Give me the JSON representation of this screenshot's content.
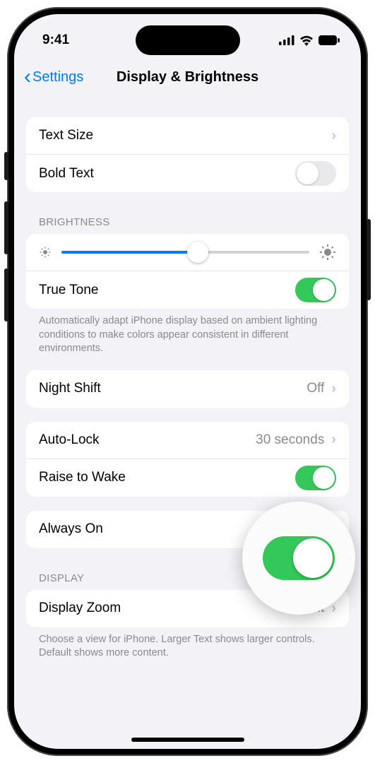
{
  "status": {
    "time": "9:41"
  },
  "nav": {
    "back": "Settings",
    "title": "Display & Brightness"
  },
  "rows": {
    "text_size": "Text Size",
    "bold_text": "Bold Text",
    "true_tone": "True Tone",
    "night_shift": "Night Shift",
    "night_shift_val": "Off",
    "auto_lock": "Auto-Lock",
    "auto_lock_val": "30 seconds",
    "raise": "Raise to Wake",
    "always_on": "Always On",
    "display_zoom": "Display Zoom",
    "display_zoom_val": "Default"
  },
  "headers": {
    "brightness": "BRIGHTNESS",
    "display": "DISPLAY"
  },
  "footers": {
    "true_tone": "Automatically adapt iPhone display based on ambient lighting conditions to make colors appear consistent in different environments.",
    "display": "Choose a view for iPhone. Larger Text shows larger controls. Default shows more content."
  },
  "brightness_pct": 55
}
